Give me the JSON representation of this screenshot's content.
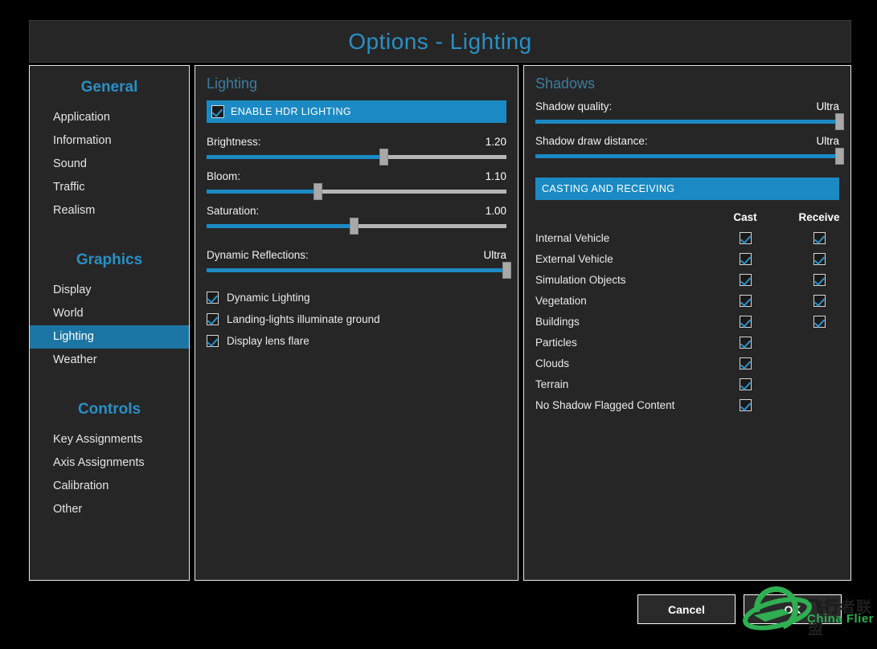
{
  "window": {
    "title": "Options - Lighting",
    "accent": "#1b8ac4",
    "title_color": "#2a8fc4",
    "panel_bg": "#262626"
  },
  "sidebar": {
    "groups": [
      {
        "title": "General",
        "items": [
          {
            "label": "Application",
            "selected": false
          },
          {
            "label": "Information",
            "selected": false
          },
          {
            "label": "Sound",
            "selected": false
          },
          {
            "label": "Traffic",
            "selected": false
          },
          {
            "label": "Realism",
            "selected": false
          }
        ]
      },
      {
        "title": "Graphics",
        "items": [
          {
            "label": "Display",
            "selected": false
          },
          {
            "label": "World",
            "selected": false
          },
          {
            "label": "Lighting",
            "selected": true
          },
          {
            "label": "Weather",
            "selected": false
          }
        ]
      },
      {
        "title": "Controls",
        "items": [
          {
            "label": "Key Assignments",
            "selected": false
          },
          {
            "label": "Axis Assignments",
            "selected": false
          },
          {
            "label": "Calibration",
            "selected": false
          },
          {
            "label": "Other",
            "selected": false
          }
        ]
      }
    ]
  },
  "lighting": {
    "section_title": "Lighting",
    "hdr_banner": {
      "label": "ENABLE HDR LIGHTING",
      "checked": true
    },
    "sliders": [
      {
        "label": "Brightness:",
        "value": "1.20",
        "percent": 59
      },
      {
        "label": "Bloom:",
        "value": "1.10",
        "percent": 37
      },
      {
        "label": "Saturation:",
        "value": "1.00",
        "percent": 49
      }
    ],
    "reflections": {
      "label": "Dynamic Reflections:",
      "value": "Ultra",
      "percent": 100
    },
    "checkboxes": [
      {
        "label": "Dynamic Lighting",
        "checked": true
      },
      {
        "label": "Landing-lights illuminate ground",
        "checked": true
      },
      {
        "label": "Display lens flare",
        "checked": true
      }
    ]
  },
  "shadows": {
    "section_title": "Shadows",
    "sliders": [
      {
        "label": "Shadow quality:",
        "value": "Ultra",
        "percent": 100
      },
      {
        "label": "Shadow draw distance:",
        "value": "Ultra",
        "percent": 100
      }
    ],
    "banner": "CASTING AND RECEIVING",
    "table": {
      "columns": [
        "",
        "Cast",
        "Receive"
      ],
      "rows": [
        {
          "label": "Internal Vehicle",
          "cast": true,
          "cast_shown": true,
          "receive": true,
          "receive_shown": true
        },
        {
          "label": "External Vehicle",
          "cast": true,
          "cast_shown": true,
          "receive": true,
          "receive_shown": true
        },
        {
          "label": "Simulation Objects",
          "cast": true,
          "cast_shown": true,
          "receive": true,
          "receive_shown": true
        },
        {
          "label": "Vegetation",
          "cast": true,
          "cast_shown": true,
          "receive": true,
          "receive_shown": true
        },
        {
          "label": "Buildings",
          "cast": true,
          "cast_shown": true,
          "receive": true,
          "receive_shown": true
        },
        {
          "label": "Particles",
          "cast": true,
          "cast_shown": true,
          "receive": false,
          "receive_shown": false
        },
        {
          "label": "Clouds",
          "cast": true,
          "cast_shown": true,
          "receive": false,
          "receive_shown": false
        },
        {
          "label": "Terrain",
          "cast": true,
          "cast_shown": true,
          "receive": false,
          "receive_shown": false
        },
        {
          "label": "No Shadow Flagged Content",
          "cast": true,
          "cast_shown": true,
          "receive": false,
          "receive_shown": false
        }
      ]
    }
  },
  "footer": {
    "cancel_label": "Cancel",
    "ok_label": "OK"
  },
  "watermark": {
    "text_cn": "飞行者联盟",
    "text_en": "China Flier",
    "color": "#2fae52"
  }
}
